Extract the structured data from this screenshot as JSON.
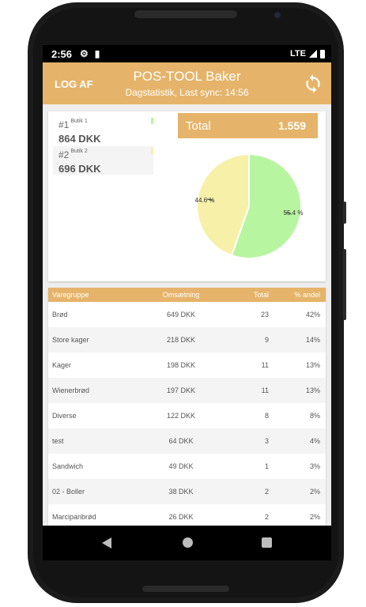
{
  "statusbar": {
    "time": "2:56",
    "network": "LTE"
  },
  "appbar": {
    "logout": "LOG AF",
    "title": "POS-TOOL Baker",
    "subtitle": "Dagstatistik, Last sync: 14:56"
  },
  "shops": [
    {
      "rank": "#1",
      "name": "Butik 1",
      "amount": "864 DKK",
      "color": "#b8f5a0"
    },
    {
      "rank": "#2",
      "name": "Butik 2",
      "amount": "696 DKK",
      "color": "#f7f0a8"
    }
  ],
  "total": {
    "label": "Total",
    "value": "1.559"
  },
  "chart_data": {
    "type": "pie",
    "slices": [
      {
        "label": "55.4 %",
        "value": 55.4,
        "color": "#b8f5a0"
      },
      {
        "label": "44.6 %",
        "value": 44.6,
        "color": "#f7f0a8"
      }
    ]
  },
  "table": {
    "headers": [
      "Varegruppe",
      "Omsætning",
      "Total",
      "% andel"
    ],
    "rows": [
      [
        "Brød",
        "649 DKK",
        "23",
        "42%"
      ],
      [
        "Store kager",
        "218 DKK",
        "9",
        "14%"
      ],
      [
        "Kager",
        "198 DKK",
        "11",
        "13%"
      ],
      [
        "Wienerbrød",
        "197 DKK",
        "11",
        "13%"
      ],
      [
        "Diverse",
        "122 DKK",
        "8",
        "8%"
      ],
      [
        "test",
        "64 DKK",
        "3",
        "4%"
      ],
      [
        "Sandwich",
        "49 DKK",
        "1",
        "3%"
      ],
      [
        "02 - Boller",
        "38 DKK",
        "2",
        "2%"
      ],
      [
        "Marcipanbrød",
        "26 DKK",
        "2",
        "2%"
      ]
    ]
  }
}
